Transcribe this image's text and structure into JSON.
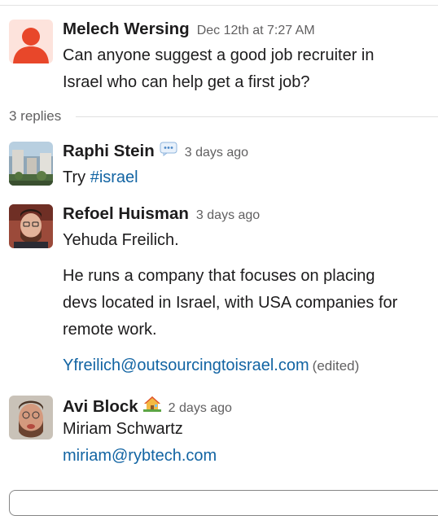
{
  "parent": {
    "author": "Melech Wersing",
    "timestamp": "Dec 12th at 7:27 AM",
    "text_line1": "Can anyone suggest a good job recruiter in",
    "text_line2": "Israel who can help get a first job?"
  },
  "replies_divider": {
    "label": "3 replies"
  },
  "replies": [
    {
      "author": "Raphi Stein",
      "status_icon": "speech-bubble-icon",
      "timestamp": "3 days ago",
      "text_prefix": "Try ",
      "channel": "#israel"
    },
    {
      "author": "Refoel Huisman",
      "timestamp": "3 days ago",
      "para1": "Yehuda Freilich.",
      "para2_line1": "He runs a company that focuses on placing",
      "para2_line2": "devs located in Israel, with USA companies for",
      "para2_line3": "remote work.",
      "email": "Yfreilich@outsourcingtoisrael.com",
      "edited": "(edited)"
    },
    {
      "author": "Avi Block",
      "status_icon": "house-icon",
      "timestamp": "2 days ago",
      "line1": "Miriam Schwartz",
      "email": "miriam@rybtech.com"
    }
  ],
  "colors": {
    "link": "#1264a3",
    "text": "#1d1c1d",
    "muted": "#616061",
    "avatar_default": "#e8472a"
  }
}
